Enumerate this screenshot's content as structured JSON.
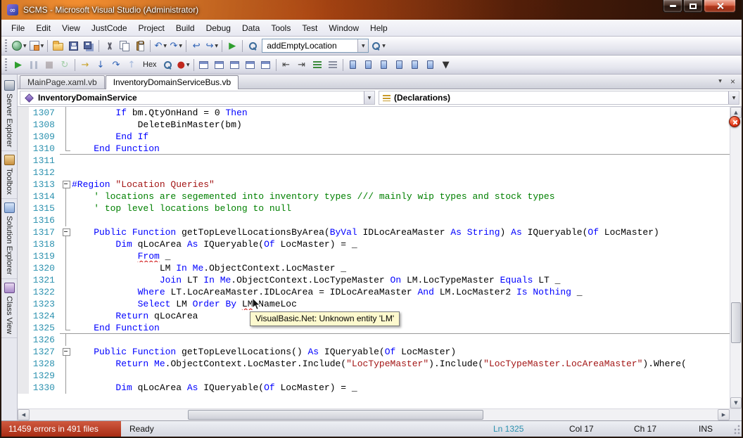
{
  "window": {
    "title": "SCMS - Microsoft Visual Studio (Administrator)"
  },
  "colors": {
    "keyword": "#0000FF",
    "comment": "#008000",
    "string": "#A31515",
    "line_number": "#2B91AF",
    "error_badge": "#E23414",
    "errors_bar": "#A82C14",
    "tooltip_bg": "#FDF9CE"
  },
  "menu": {
    "items": [
      "File",
      "Edit",
      "View",
      "JustCode",
      "Project",
      "Build",
      "Debug",
      "Data",
      "Tools",
      "Test",
      "Window",
      "Help"
    ]
  },
  "toolbar1": [
    {
      "n": "new-project-button",
      "t": "css",
      "i": "newproj",
      "dd": true
    },
    {
      "n": "add-new-item-button",
      "t": "css",
      "i": "additem",
      "dd": true
    },
    {
      "t": "sep"
    },
    {
      "n": "open-file-button",
      "t": "css",
      "i": "folder"
    },
    {
      "n": "save-button",
      "t": "css",
      "i": "floppy"
    },
    {
      "n": "save-all-button",
      "t": "css",
      "i": "floppyall"
    },
    {
      "t": "sep"
    },
    {
      "n": "cut-button",
      "t": "css",
      "i": "cut"
    },
    {
      "n": "copy-button",
      "t": "css",
      "i": "copy"
    },
    {
      "n": "paste-button",
      "t": "css",
      "i": "paste"
    },
    {
      "t": "sep"
    },
    {
      "n": "undo-button",
      "t": "g",
      "g": "↶",
      "c": "#2b5fb4",
      "dd": true
    },
    {
      "n": "redo-button",
      "t": "g",
      "g": "↷",
      "c": "#2b5fb4",
      "dd": true
    },
    {
      "t": "sep"
    },
    {
      "n": "navigate-backward-button",
      "t": "g",
      "g": "↩",
      "c": "#2b5fb4"
    },
    {
      "n": "navigate-forward-button",
      "t": "g",
      "g": "↪",
      "c": "#2b5fb4",
      "dd": true
    },
    {
      "t": "sep"
    },
    {
      "n": "start-debugging-button",
      "t": "g",
      "g": "▶",
      "c": "#2e9e2e"
    },
    {
      "t": "sep"
    },
    {
      "n": "find-in-files-button",
      "t": "css",
      "i": "mag"
    },
    {
      "n": "find-combo",
      "t": "combo",
      "v": "addEmptyLocation"
    },
    {
      "n": "find-symbol-button",
      "t": "css",
      "i": "mag",
      "dd": true
    }
  ],
  "toolbar2": [
    {
      "n": "start-debug-button",
      "t": "g",
      "g": "▶",
      "c": "#2e9e2e"
    },
    {
      "n": "break-all-button",
      "t": "css",
      "i": "pause",
      "dis": true
    },
    {
      "n": "stop-debugging-button",
      "t": "g",
      "g": "■",
      "c": "#6a5a5a",
      "dis": true
    },
    {
      "n": "restart-button",
      "t": "g",
      "g": "↻",
      "c": "#2e9e2e",
      "dis": true
    },
    {
      "t": "sep"
    },
    {
      "n": "show-next-statement-button",
      "t": "g",
      "g": "→",
      "c": "#c9a227"
    },
    {
      "n": "step-into-button",
      "t": "g",
      "g": "↓",
      "c": "#2b5fb4"
    },
    {
      "n": "step-over-button",
      "t": "g",
      "g": "↷",
      "c": "#2b5fb4"
    },
    {
      "n": "step-out-button",
      "t": "g",
      "g": "↑",
      "c": "#2b5fb4",
      "dis": true
    },
    {
      "n": "hex-button",
      "t": "text",
      "label": "Hex"
    },
    {
      "n": "memory-button",
      "t": "css",
      "i": "mag"
    },
    {
      "n": "breakpoint-button",
      "t": "g",
      "g": "●",
      "c": "#c0281e",
      "dd": true
    },
    {
      "t": "sep"
    },
    {
      "n": "solution-explorer-window-button",
      "t": "css",
      "i": "win"
    },
    {
      "n": "properties-window-button",
      "t": "css",
      "i": "win"
    },
    {
      "n": "object-browser-button",
      "t": "css",
      "i": "win"
    },
    {
      "n": "output-window-button",
      "t": "css",
      "i": "win"
    },
    {
      "n": "immediate-window-button",
      "t": "css",
      "i": "win"
    },
    {
      "t": "sep"
    },
    {
      "n": "decrease-indent-button",
      "t": "g",
      "g": "⇤",
      "c": "#444"
    },
    {
      "n": "increase-indent-button",
      "t": "g",
      "g": "⇥",
      "c": "#444"
    },
    {
      "n": "comment-button",
      "t": "css",
      "i": "comment"
    },
    {
      "n": "uncomment-button",
      "t": "css",
      "i": "uncomment"
    },
    {
      "t": "sep"
    },
    {
      "n": "toggle-bookmark-button",
      "t": "css",
      "i": "bookmark"
    },
    {
      "n": "prev-bookmark-button",
      "t": "css",
      "i": "bookmark"
    },
    {
      "n": "next-bookmark-button",
      "t": "css",
      "i": "bookmark"
    },
    {
      "n": "prev-bookmark-folder-button",
      "t": "css",
      "i": "bookmark"
    },
    {
      "n": "next-bookmark-folder-button",
      "t": "css",
      "i": "bookmark"
    },
    {
      "n": "clear-bookmarks-button",
      "t": "css",
      "i": "bookmark"
    },
    {
      "n": "toolbar-options-button",
      "t": "g",
      "g": "▼",
      "c": "#333"
    }
  ],
  "side_tabs": [
    {
      "label": "Server Explorer",
      "icon": "server"
    },
    {
      "label": "Toolbox",
      "icon": "toolbox"
    },
    {
      "label": "Solution Explorer",
      "icon": "solution"
    },
    {
      "label": "Class View",
      "icon": "class"
    }
  ],
  "doc_tabs": [
    {
      "label": "MainPage.xaml.vb",
      "active": false
    },
    {
      "label": "InventoryDomainServiceBus.vb",
      "active": true
    }
  ],
  "navbar": {
    "types_combo": "InventoryDomainService",
    "members_combo": "(Declarations)"
  },
  "editor": {
    "tooltip": "VisualBasic.Net: Unknown entity 'LM'",
    "lines": [
      {
        "num": "1307",
        "fold": "line",
        "segs": [
          [
            "p",
            "        "
          ],
          [
            "k",
            "If"
          ],
          [
            "p",
            " bm.QtyOnHand = 0 "
          ],
          [
            "k",
            "Then"
          ]
        ]
      },
      {
        "num": "1308",
        "fold": "line",
        "segs": [
          [
            "p",
            "            DeleteBinMaster(bm)"
          ]
        ]
      },
      {
        "num": "1309",
        "fold": "line",
        "segs": [
          [
            "p",
            "        "
          ],
          [
            "k",
            "End If"
          ]
        ]
      },
      {
        "num": "1310",
        "fold": "end",
        "sep": true,
        "segs": [
          [
            "p",
            "    "
          ],
          [
            "k",
            "End Function"
          ]
        ]
      },
      {
        "num": "1311",
        "fold": "",
        "segs": []
      },
      {
        "num": "1312",
        "fold": "",
        "segs": []
      },
      {
        "num": "1313",
        "fold": "box",
        "segs": [
          [
            "k",
            "#Region"
          ],
          [
            "p",
            " "
          ],
          [
            "ts",
            "\"Location Queries\""
          ]
        ]
      },
      {
        "num": "1314",
        "fold": "line",
        "segs": [
          [
            "p",
            "    "
          ],
          [
            "tc",
            "' locations are segemented into inventory types /// mainly wip types and stock types"
          ]
        ]
      },
      {
        "num": "1315",
        "fold": "line",
        "segs": [
          [
            "p",
            "    "
          ],
          [
            "tc",
            "' top level locations belong to null"
          ]
        ]
      },
      {
        "num": "1316",
        "fold": "line",
        "segs": []
      },
      {
        "num": "1317",
        "fold": "box",
        "segs": [
          [
            "p",
            "    "
          ],
          [
            "k",
            "Public Function"
          ],
          [
            "p",
            " getTopLevelLocationsByArea("
          ],
          [
            "k",
            "ByVal"
          ],
          [
            "p",
            " IDLocAreaMaster "
          ],
          [
            "k",
            "As String"
          ],
          [
            "p",
            ") "
          ],
          [
            "k",
            "As"
          ],
          [
            "p",
            " IQueryable("
          ],
          [
            "k",
            "Of"
          ],
          [
            "p",
            " LocMaster)"
          ]
        ]
      },
      {
        "num": "1318",
        "fold": "line",
        "segs": [
          [
            "p",
            "        "
          ],
          [
            "k",
            "Dim"
          ],
          [
            "p",
            " qLocArea "
          ],
          [
            "k",
            "As"
          ],
          [
            "p",
            " IQueryable("
          ],
          [
            "k",
            "Of"
          ],
          [
            "p",
            " LocMaster) = _"
          ]
        ]
      },
      {
        "num": "1319",
        "fold": "line",
        "segs": [
          [
            "p",
            "            "
          ],
          [
            "ke",
            "From"
          ],
          [
            "p",
            " _"
          ]
        ]
      },
      {
        "num": "1320",
        "fold": "line",
        "segs": [
          [
            "p",
            "                LM "
          ],
          [
            "k",
            "In"
          ],
          [
            "p",
            " "
          ],
          [
            "k",
            "Me"
          ],
          [
            "p",
            ".ObjectContext.LocMaster _"
          ]
        ]
      },
      {
        "num": "1321",
        "fold": "line",
        "segs": [
          [
            "p",
            "                "
          ],
          [
            "k",
            "Join"
          ],
          [
            "p",
            " LT "
          ],
          [
            "k",
            "In"
          ],
          [
            "p",
            " "
          ],
          [
            "k",
            "Me"
          ],
          [
            "p",
            ".ObjectContext.LocTypeMaster "
          ],
          [
            "k",
            "On"
          ],
          [
            "p",
            " LM.LocTypeMaster "
          ],
          [
            "k",
            "Equals"
          ],
          [
            "p",
            " LT _"
          ]
        ]
      },
      {
        "num": "1322",
        "fold": "line",
        "segs": [
          [
            "p",
            "            "
          ],
          [
            "k",
            "Where"
          ],
          [
            "p",
            " LT.LocAreaMaster.IDLocArea = IDLocAreaMaster "
          ],
          [
            "k",
            "And"
          ],
          [
            "p",
            " LM.LocMaster2 "
          ],
          [
            "k",
            "Is"
          ],
          [
            "p",
            " "
          ],
          [
            "k",
            "Nothing"
          ],
          [
            "p",
            " _"
          ]
        ]
      },
      {
        "num": "1323",
        "fold": "line",
        "segs": [
          [
            "p",
            "            "
          ],
          [
            "k",
            "Select"
          ],
          [
            "p",
            " LM "
          ],
          [
            "k",
            "Order By"
          ],
          [
            "p",
            " "
          ],
          [
            "te",
            "LM"
          ],
          [
            "p",
            ".NameLoc"
          ]
        ]
      },
      {
        "num": "1324",
        "fold": "line",
        "segs": [
          [
            "p",
            "        "
          ],
          [
            "k",
            "Return"
          ],
          [
            "p",
            " qLocArea"
          ]
        ]
      },
      {
        "num": "1325",
        "fold": "end",
        "sep": true,
        "segs": [
          [
            "p",
            "    "
          ],
          [
            "k",
            "End Function"
          ]
        ]
      },
      {
        "num": "1326",
        "fold": "line",
        "segs": []
      },
      {
        "num": "1327",
        "fold": "box",
        "segs": [
          [
            "p",
            "    "
          ],
          [
            "k",
            "Public Function"
          ],
          [
            "p",
            " getTopLevelLocations() "
          ],
          [
            "k",
            "As"
          ],
          [
            "p",
            " IQueryable("
          ],
          [
            "k",
            "Of"
          ],
          [
            "p",
            " LocMaster)"
          ]
        ]
      },
      {
        "num": "1328",
        "fold": "line",
        "segs": [
          [
            "p",
            "        "
          ],
          [
            "k",
            "Return"
          ],
          [
            "p",
            " "
          ],
          [
            "k",
            "Me"
          ],
          [
            "p",
            ".ObjectContext.LocMaster.Include("
          ],
          [
            "ts",
            "\"LocTypeMaster\""
          ],
          [
            "p",
            ").Include("
          ],
          [
            "ts",
            "\"LocTypeMaster.LocAreaMaster\""
          ],
          [
            "p",
            ").Where("
          ]
        ]
      },
      {
        "num": "1329",
        "fold": "line",
        "segs": []
      },
      {
        "num": "1330",
        "fold": "line",
        "segs": [
          [
            "p",
            "        "
          ],
          [
            "k",
            "Dim"
          ],
          [
            "p",
            " qLocArea "
          ],
          [
            "k",
            "As"
          ],
          [
            "p",
            " IQueryable("
          ],
          [
            "k",
            "Of"
          ],
          [
            "p",
            " LocMaster) = _"
          ]
        ]
      }
    ]
  },
  "status": {
    "errors": "11459 errors in 491 files",
    "ready": "Ready",
    "ln": "Ln 1325",
    "col": "Col 17",
    "ch": "Ch 17",
    "mode": "INS"
  }
}
